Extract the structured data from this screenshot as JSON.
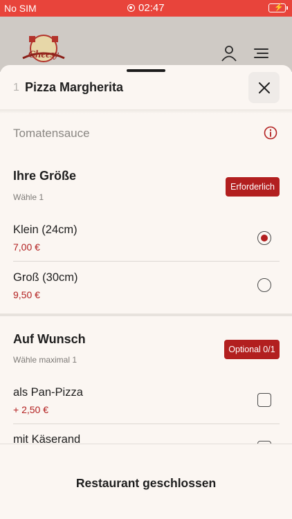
{
  "status_bar": {
    "carrier": "No SIM",
    "time": "02:47",
    "battery_color": "#7fd35b"
  },
  "app_header": {
    "logo_text": "Cheesy",
    "icons": [
      "user-icon",
      "menu-icon"
    ]
  },
  "product_sheet": {
    "quantity": "1",
    "title": "Pizza Margherita",
    "description": "Tomatensauce",
    "groups": [
      {
        "title": "Ihre Größe",
        "subtitle": "Wähle 1",
        "badge": "Erforderlich",
        "options": [
          {
            "name": "Klein (24cm)",
            "price": "7,00 €",
            "selected": true
          },
          {
            "name": "Groß (30cm)",
            "price": "9,50 €",
            "selected": false
          }
        ]
      },
      {
        "title": "Auf Wunsch",
        "subtitle": "Wähle maximal 1",
        "badge": "Optional 0/1",
        "options": [
          {
            "name": "als Pan-Pizza",
            "price": "+ 2,50 €",
            "checked": false
          },
          {
            "name": "mit Käserand",
            "checked": false
          }
        ]
      }
    ]
  },
  "footer": {
    "label": "Restaurant geschlossen"
  },
  "colors": {
    "status_bar": "#e8443b",
    "accent": "#b21f1f",
    "sheet_background": "#fbf6f2"
  }
}
